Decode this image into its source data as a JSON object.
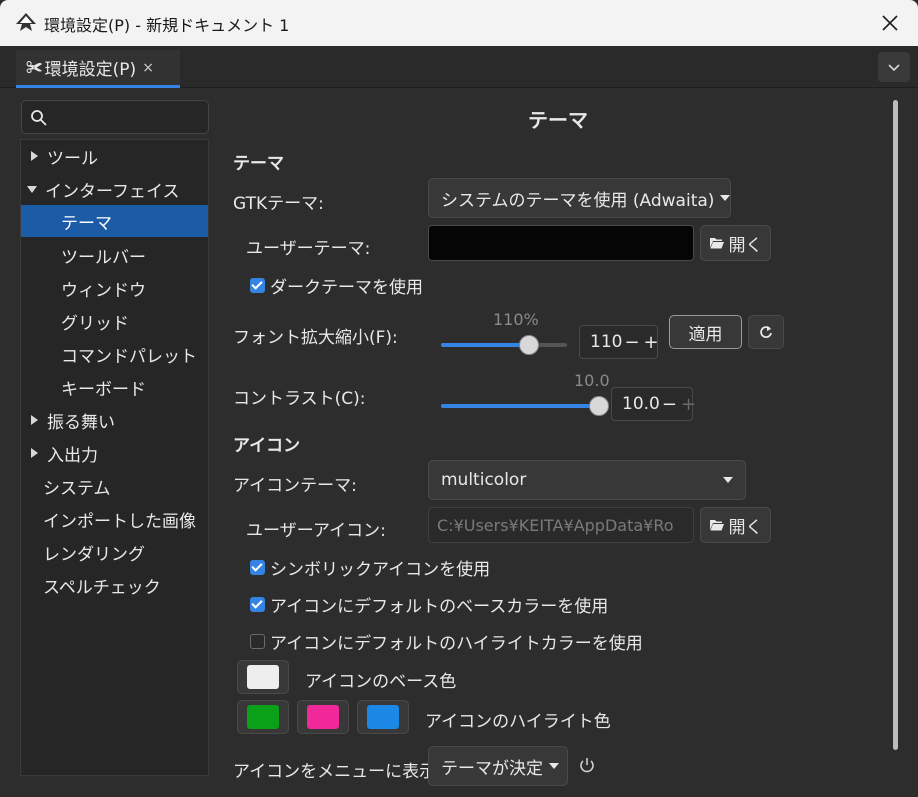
{
  "window": {
    "title": "環境設定(P) - 新規ドキュメント 1",
    "close_glyph": "✕"
  },
  "tab": {
    "icon": "✀",
    "label": "環境設定(P)",
    "close_glyph": "×"
  },
  "sidebar": {
    "search_placeholder": "",
    "items": [
      {
        "label": "ツール",
        "level": 0,
        "expander": "collapsed"
      },
      {
        "label": "インターフェイス",
        "level": 0,
        "expander": "expanded"
      },
      {
        "label": "テーマ",
        "level": 1,
        "selected": true
      },
      {
        "label": "ツールバー",
        "level": 1
      },
      {
        "label": "ウィンドウ",
        "level": 1
      },
      {
        "label": "グリッド",
        "level": 1
      },
      {
        "label": "コマンドパレット",
        "level": 1
      },
      {
        "label": "キーボード",
        "level": 1
      },
      {
        "label": "振る舞い",
        "level": 0,
        "expander": "collapsed"
      },
      {
        "label": "入出力",
        "level": 0,
        "expander": "collapsed"
      },
      {
        "label": "システム",
        "level": 0
      },
      {
        "label": "インポートした画像",
        "level": 0
      },
      {
        "label": "レンダリング",
        "level": 0
      },
      {
        "label": "スペルチェック",
        "level": 0
      }
    ]
  },
  "main": {
    "page_title": "テーマ",
    "theme_section": "テーマ",
    "gtk_theme_label": "GTKテーマ:",
    "gtk_theme_value": "システムのテーマを使用 (Adwaita)",
    "user_theme_label": "ユーザーテーマ:",
    "open_label": "開く",
    "dark_theme_label": "ダークテーマを使用",
    "dark_theme_checked": true,
    "font_scale_label": "フォント拡大縮小(F):",
    "font_scale_percent": "110%",
    "font_scale_value": "110",
    "font_scale_fraction": 0.7,
    "apply_label": "適用",
    "contrast_label": "コントラスト(C):",
    "contrast_top_value": "10.0",
    "contrast_value": "10.0",
    "contrast_fraction": 1.0,
    "spin_minus": "−",
    "spin_plus": "+",
    "icon_section": "アイコン",
    "icon_theme_label": "アイコンテーマ:",
    "icon_theme_value": "multicolor",
    "user_icon_label": "ユーザーアイコン:",
    "user_icon_value": "C:¥Users¥KEITA¥AppData¥Ro",
    "symbolic_icons_label": "シンボリックアイコンを使用",
    "symbolic_icons_checked": true,
    "default_base_color_label": "アイコンにデフォルトのベースカラーを使用",
    "default_base_color_checked": true,
    "default_highlight_color_label": "アイコンにデフォルトのハイライトカラーを使用",
    "default_highlight_color_checked": false,
    "base_color_label": "アイコンのベース色",
    "base_color": "#eeeeee",
    "highlight_color_label": "アイコンのハイライト色",
    "highlight_colors": [
      "#0aa017",
      "#f0289a",
      "#1a88e4"
    ],
    "menu_icons_label": "アイコンをメニューに表示",
    "menu_icons_value": "テーマが決定"
  },
  "colors": {
    "accent": "#3584e4",
    "selection": "#1c5ba6",
    "background": "#2d2d2d"
  }
}
